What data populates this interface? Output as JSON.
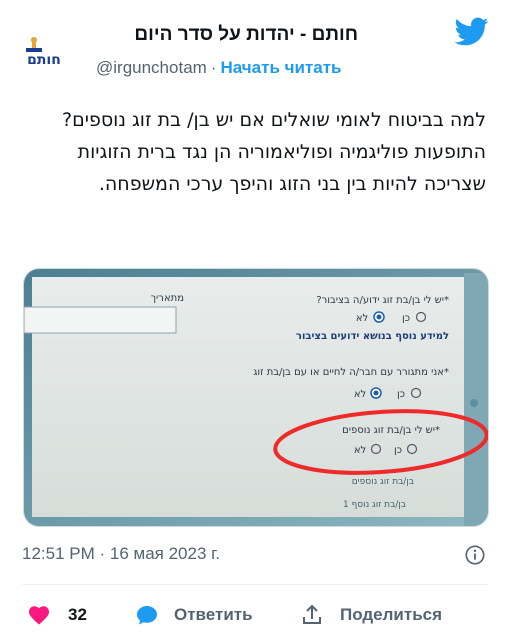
{
  "author": {
    "display_name": "חותם - יהדות על סדר היום",
    "handle": "@irgunchotam",
    "separator": "·",
    "follow_label": "Начать читать",
    "avatar_text": "חותם"
  },
  "tweet": {
    "lines": [
      "למה בביטוח לאומי שואלים אם יש בן/ בת זוג נוספים?",
      "התופעות פוליגמיה ופוליאמוריה הן נגד ברית הזוגיות שצריכה להיות בין בני הזוג והיפך ערכי המשפחה."
    ]
  },
  "photo_form": {
    "q1": "*יש לי בן/בת זוג ידוע/ה בציבור?",
    "q1_yes": "כן",
    "q1_no": "לא",
    "q1_info": "למידע נוסף בנושא ידועים בציבור",
    "date_label": "מתאריך",
    "q2": "*אני מתגורר עם חבר/ה לחיים או עם בן/בת זוג",
    "q2_yes": "כן",
    "q2_no": "לא",
    "q3": "*יש לי בן/בת זוג נוספים",
    "q3_yes": "כן",
    "q3_no": "לא",
    "q3_sub1": "בן/בת זוג נוספים",
    "q3_sub2": "בן/בת זוג נוסף 1"
  },
  "meta": {
    "timestamp": "12:51 PM · 16 мая 2023 г."
  },
  "actions": {
    "like_count": "32",
    "reply_label": "Ответить",
    "share_label": "Поделиться"
  },
  "colors": {
    "brand_blue": "#1d9bf0",
    "like_pink": "#f91880",
    "muted": "#536471"
  }
}
